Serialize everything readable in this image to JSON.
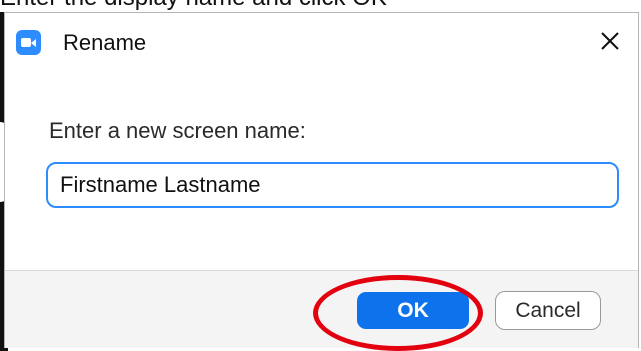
{
  "top_caption": "Enter the display name and click OK",
  "dialog": {
    "title": "Rename",
    "app_icon": "zoom-camera-icon",
    "close_icon": "close-icon",
    "prompt": "Enter a new screen name:",
    "input_value": "Firstname Lastname",
    "ok_label": "OK",
    "cancel_label": "Cancel"
  },
  "colors": {
    "accent_blue": "#0e72ed",
    "input_border": "#2d8cff",
    "highlight_red": "#e3000f"
  }
}
